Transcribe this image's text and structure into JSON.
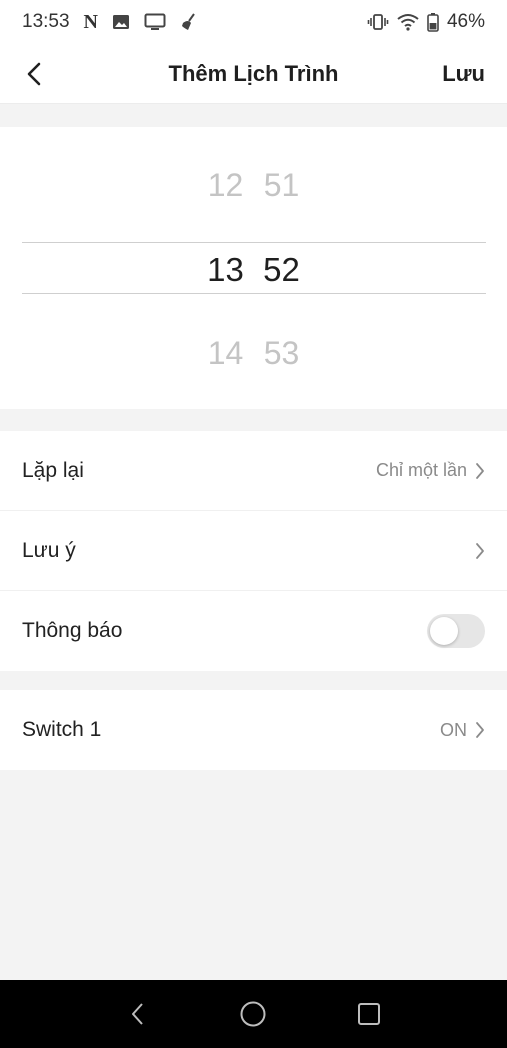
{
  "status_bar": {
    "time": "13:53",
    "battery": "46%",
    "icons_left": [
      "netflix-n-icon",
      "image-icon",
      "cast-screen-icon",
      "broom-icon"
    ],
    "icons_right": [
      "vibrate-icon",
      "wifi-icon",
      "battery-icon"
    ],
    "netflix_glyph": "N"
  },
  "header": {
    "title": "Thêm Lịch Trình",
    "save_label": "Lưu"
  },
  "picker": {
    "prev": {
      "hour": "12",
      "minute": "51"
    },
    "selected": {
      "hour": "13",
      "minute": "52"
    },
    "next": {
      "hour": "14",
      "minute": "53"
    }
  },
  "settings": {
    "repeat": {
      "label": "Lặp lại",
      "value": "Chỉ một lần"
    },
    "note": {
      "label": "Lưu ý"
    },
    "notification": {
      "label": "Thông báo",
      "enabled": false
    }
  },
  "action": {
    "label": "Switch 1",
    "value": "ON"
  },
  "colors": {
    "background": "#f3f3f3",
    "card": "#ffffff",
    "text_primary": "#1f1f1f",
    "text_muted": "#8a8a8a",
    "picker_faded": "#c4c4c4",
    "toggle_off": "#e6e6e6"
  }
}
